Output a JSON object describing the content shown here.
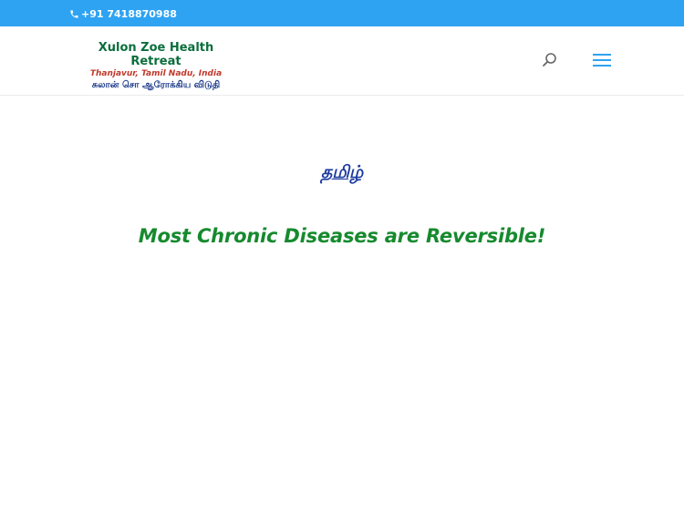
{
  "topbar": {
    "phone_number": "+91 7418870988",
    "phone_icon": "phone-icon",
    "background_color": "#2ea3f2"
  },
  "header": {
    "logo": {
      "title": "Xulon Zoe Health Retreat",
      "location": "Thanjavur, Tamil Nadu, India",
      "tamil_name": "சுலான் சொ ஆரோக்கிய விடுதி"
    },
    "search_icon": "search-icon",
    "menu_icon": "hamburger-menu-icon"
  },
  "main": {
    "language_link": "தமிழ்",
    "headline": "Most Chronic Diseases are Reversible!"
  },
  "colors": {
    "accent": "#2ea3f2",
    "headline": "#168a2e",
    "link": "#1b3aa0"
  }
}
